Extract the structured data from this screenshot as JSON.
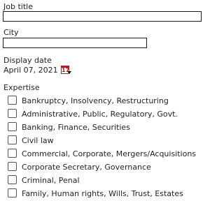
{
  "job_title": {
    "label": "Job title",
    "value": ""
  },
  "city": {
    "label": "City",
    "value": ""
  },
  "display_date": {
    "label": "Display date",
    "value": "April 07, 2021",
    "calendar_icon_text": "17"
  },
  "expertise": {
    "label": "Expertise",
    "options": [
      {
        "label": "Bankruptcy, Insolvency, Restructuring",
        "checked": false
      },
      {
        "label": "Administrative, Public, Regulatory, Govt.",
        "checked": false
      },
      {
        "label": "Banking, Finance, Securities",
        "checked": false
      },
      {
        "label": "Civil law",
        "checked": false
      },
      {
        "label": "Commercial, Corporate, Mergers/Acquisitions",
        "checked": false
      },
      {
        "label": "Corporate Secretary, Governance",
        "checked": false
      },
      {
        "label": "Criminal, Penal",
        "checked": false
      },
      {
        "label": "Family, Human rights, Wills, Trust, Estates",
        "checked": false
      }
    ]
  },
  "colors": {
    "calendar_accent": "#b42020",
    "input_border": "#1a1a1a",
    "text": "#222222"
  }
}
